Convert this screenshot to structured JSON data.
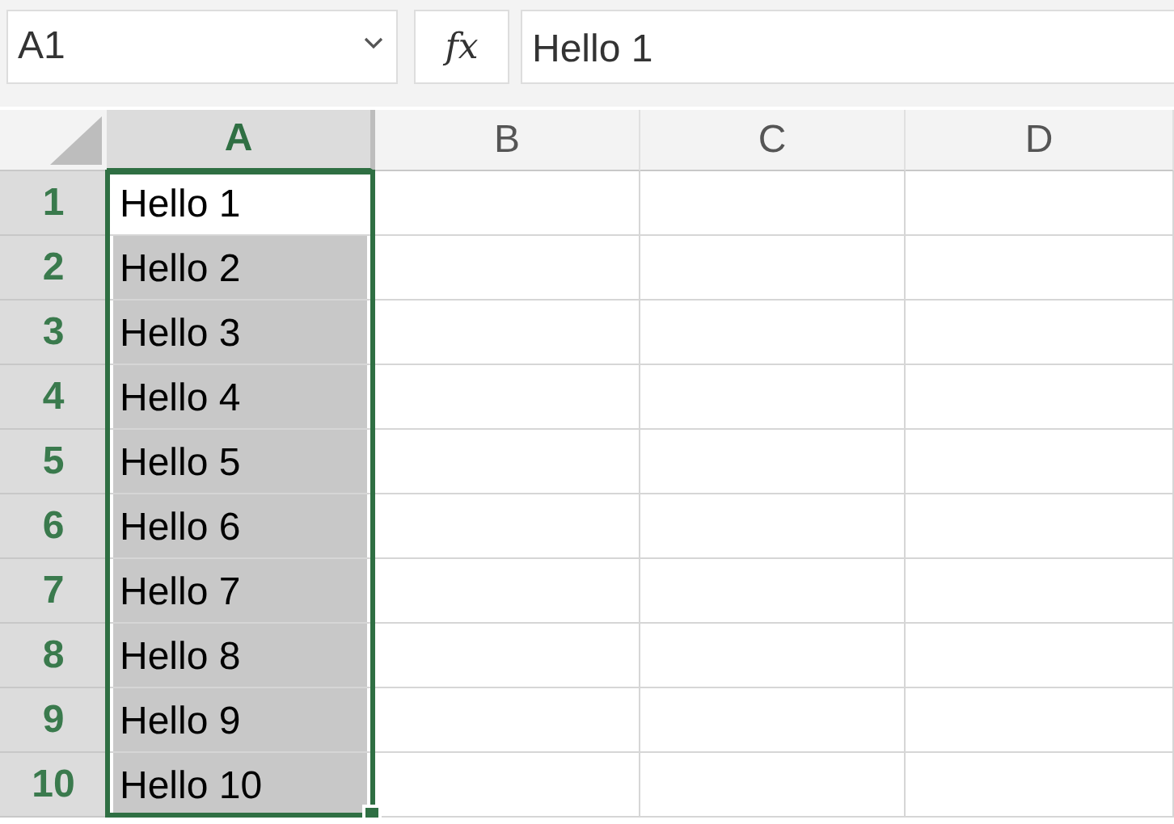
{
  "name_box": {
    "value": "A1"
  },
  "formula_bar": {
    "fx": "fx",
    "value": "Hello 1"
  },
  "columns": [
    {
      "label": "A",
      "selected": true
    },
    {
      "label": "B",
      "selected": false
    },
    {
      "label": "C",
      "selected": false
    },
    {
      "label": "D",
      "selected": false
    }
  ],
  "rows": [
    {
      "label": "1",
      "selected": true,
      "cells": [
        {
          "value": "Hello 1",
          "selected": true,
          "active": true
        }
      ]
    },
    {
      "label": "2",
      "selected": true,
      "cells": [
        {
          "value": "Hello 2",
          "selected": true,
          "active": false
        }
      ]
    },
    {
      "label": "3",
      "selected": true,
      "cells": [
        {
          "value": "Hello 3",
          "selected": true,
          "active": false
        }
      ]
    },
    {
      "label": "4",
      "selected": true,
      "cells": [
        {
          "value": "Hello 4",
          "selected": true,
          "active": false
        }
      ]
    },
    {
      "label": "5",
      "selected": true,
      "cells": [
        {
          "value": "Hello 5",
          "selected": true,
          "active": false
        }
      ]
    },
    {
      "label": "6",
      "selected": true,
      "cells": [
        {
          "value": "Hello 6",
          "selected": true,
          "active": false
        }
      ]
    },
    {
      "label": "7",
      "selected": true,
      "cells": [
        {
          "value": "Hello 7",
          "selected": true,
          "active": false
        }
      ]
    },
    {
      "label": "8",
      "selected": true,
      "cells": [
        {
          "value": "Hello 8",
          "selected": true,
          "active": false
        }
      ]
    },
    {
      "label": "9",
      "selected": true,
      "cells": [
        {
          "value": "Hello 9",
          "selected": true,
          "active": false
        }
      ]
    },
    {
      "label": "10",
      "selected": true,
      "cells": [
        {
          "value": "Hello 10",
          "selected": true,
          "active": false
        }
      ]
    }
  ]
}
